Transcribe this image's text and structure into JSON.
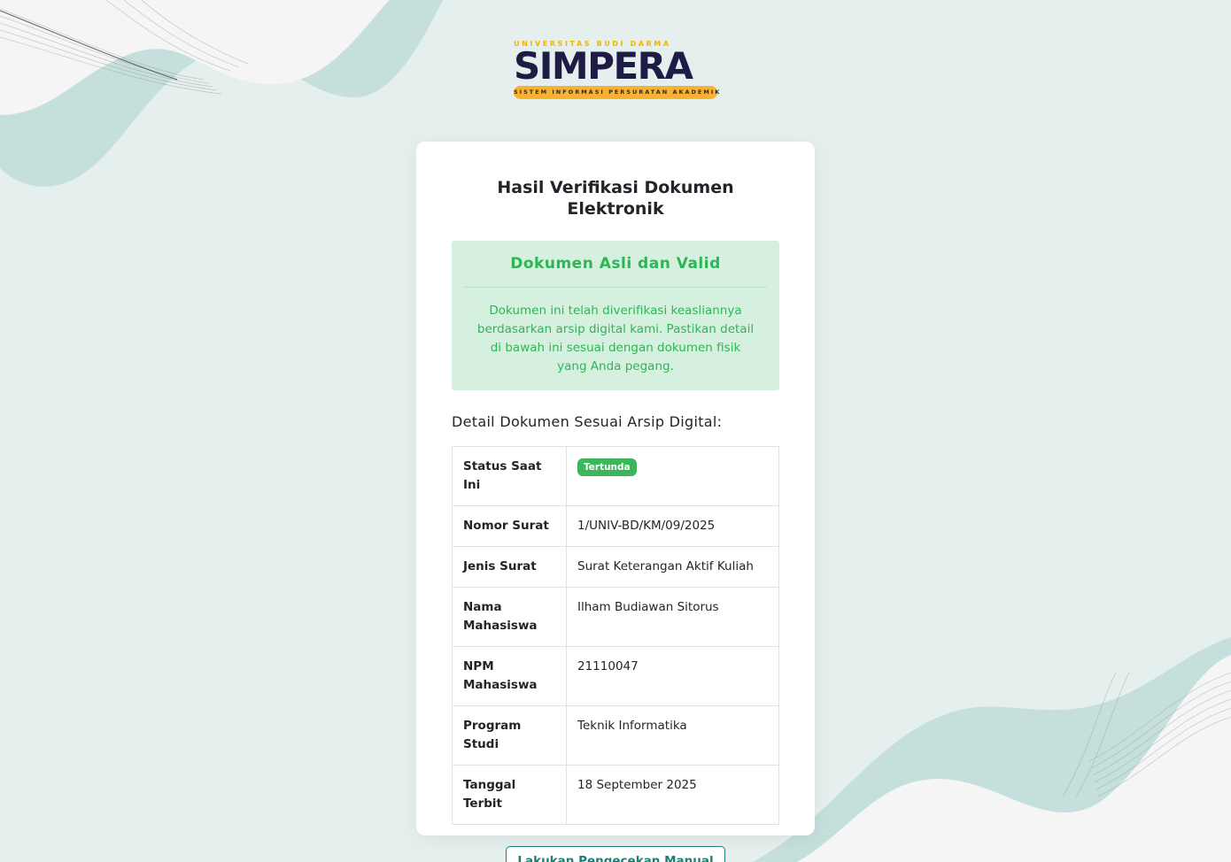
{
  "logo": {
    "university": "UNIVERSITAS BUDI DARMA",
    "app_name": "SIMPERA",
    "tagline": "SISTEM INFORMASI PERSURATAN AKADEMIK"
  },
  "card": {
    "title": "Hasil Verifikasi Dokumen Elektronik",
    "alert": {
      "heading": "Dokumen Asli dan Valid",
      "message": "Dokumen ini telah diverifikasi keasliannya berdasarkan arsip digital kami. Pastikan detail di bawah ini sesuai dengan dokumen fisik yang Anda pegang."
    },
    "details_heading": "Detail Dokumen Sesuai Arsip Digital:",
    "status": {
      "label": "Status Saat Ini",
      "value": "Tertunda"
    },
    "rows": [
      {
        "label": "Nomor Surat",
        "value": "1/UNIV-BD/KM/09/2025"
      },
      {
        "label": "Jenis Surat",
        "value": "Surat Keterangan Aktif Kuliah"
      },
      {
        "label": "Nama Mahasiswa",
        "value": "Ilham Budiawan Sitorus"
      },
      {
        "label": "NPM Mahasiswa",
        "value": "21110047"
      },
      {
        "label": "Program Studi",
        "value": "Teknik Informatika"
      },
      {
        "label": "Tanggal Terbit",
        "value": "18 September 2025"
      }
    ],
    "manual_check_button": "Lakukan Pengecekan Manual"
  },
  "colors": {
    "background": "#e5efed",
    "success_text": "#2fb457",
    "success_bg": "#d6f0df",
    "badge": "#3cb55b",
    "button_accent": "#1b7f76",
    "logo_navy": "#1e1b45",
    "logo_yellow": "#f7b234"
  }
}
